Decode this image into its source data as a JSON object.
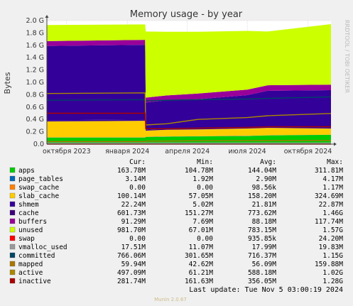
{
  "chart_data": {
    "type": "area",
    "title": "Memory usage - by year",
    "ylabel": "Bytes",
    "watermark": "RRDTOOL / TOBI OETIKER",
    "ylim": [
      0,
      2.0
    ],
    "y_unit_note": "values in GB (tick labels 'G')",
    "y_ticks": [
      "0.0",
      "0.2 G",
      "0.4 G",
      "0.6 G",
      "0.8 G",
      "1.0 G",
      "1.2 G",
      "1.4 G",
      "1.6 G",
      "1.8 G",
      "2.0 G"
    ],
    "x_tick_labels": [
      "октября 2023",
      "января 2024",
      "апреля 2024",
      "июля 2024",
      "октября 2024"
    ],
    "x_range": [
      "2023-09-01",
      "2024-11-05"
    ],
    "x_ticks": [
      "2023-10-01",
      "2024-01-01",
      "2024-04-01",
      "2024-07-01",
      "2024-10-01"
    ],
    "x": [
      "2023-09-01",
      "2024-01-28",
      "2024-01-29",
      "2024-03-01",
      "2024-04-17",
      "2024-07-01",
      "2024-08-01",
      "2024-11-05"
    ],
    "stack_series": [
      {
        "name": "apps",
        "color": "#00cc00",
        "values": [
          0.105,
          0.105,
          0.115,
          0.12,
          0.125,
          0.13,
          0.14,
          0.15
        ]
      },
      {
        "name": "page_tables",
        "color": "#0066b3",
        "values": [
          0.003,
          0.003,
          0.003,
          0.003,
          0.003,
          0.003,
          0.003,
          0.003
        ]
      },
      {
        "name": "slab_cache",
        "color": "#ffcc00",
        "values": [
          0.26,
          0.27,
          0.1,
          0.11,
          0.11,
          0.12,
          0.12,
          0.1
        ]
      },
      {
        "name": "shmem",
        "color": "#330099",
        "values": [
          0.02,
          0.02,
          0.015,
          0.015,
          0.02,
          0.02,
          0.02,
          0.02
        ]
      },
      {
        "name": "cache",
        "color": "#330099",
        "values": [
          1.2,
          1.21,
          0.44,
          0.46,
          0.47,
          0.52,
          0.58,
          0.6
        ]
      },
      {
        "name": "buffers",
        "color": "#990099",
        "values": [
          0.08,
          0.08,
          0.08,
          0.08,
          0.09,
          0.09,
          0.09,
          0.09
        ]
      },
      {
        "name": "unused",
        "color": "#ccff00",
        "values": [
          0.26,
          0.25,
          1.07,
          1.03,
          1.0,
          0.95,
          0.87,
          0.98
        ]
      }
    ],
    "line_series": [
      {
        "name": "swap",
        "color": "#ff0000",
        "values": [
          0.0,
          0.0,
          0.0,
          0.0,
          0.0,
          0.0,
          0.0,
          0.0
        ]
      },
      {
        "name": "vmalloc_used",
        "color": "#999999",
        "values": [
          0.018,
          0.018,
          0.018,
          0.018,
          0.018,
          0.018,
          0.018,
          0.018
        ]
      },
      {
        "name": "committed",
        "color": "#004466",
        "values": [
          0.71,
          0.72,
          0.7,
          0.71,
          0.72,
          0.73,
          0.74,
          0.766
        ]
      },
      {
        "name": "mapped",
        "color": "#aa7700",
        "values": [
          0.043,
          0.043,
          0.05,
          0.05,
          0.055,
          0.056,
          0.058,
          0.06
        ]
      },
      {
        "name": "active",
        "color": "#aa8800",
        "values": [
          0.82,
          0.83,
          0.31,
          0.33,
          0.4,
          0.43,
          0.46,
          0.497
        ]
      },
      {
        "name": "inactive",
        "color": "#aa0000",
        "values": [
          0.5,
          0.5,
          0.25,
          0.25,
          0.26,
          0.27,
          0.28,
          0.282
        ]
      }
    ],
    "grid": true,
    "legend_columns": [
      "Cur:",
      "Min:",
      "Avg:",
      "Max:"
    ],
    "legend": [
      {
        "name": "apps",
        "color": "#00cc00",
        "cur": "163.78M",
        "min": "104.78M",
        "avg": "144.04M",
        "max": "311.81M"
      },
      {
        "name": "page_tables",
        "color": "#0066b3",
        "cur": "3.14M",
        "min": "1.92M",
        "avg": "2.90M",
        "max": "4.17M"
      },
      {
        "name": "swap_cache",
        "color": "#ff8000",
        "cur": "0.00",
        "min": "0.00",
        "avg": "98.56k",
        "max": "1.17M"
      },
      {
        "name": "slab_cache",
        "color": "#ffcc00",
        "cur": "100.14M",
        "min": "57.05M",
        "avg": "158.20M",
        "max": "324.69M"
      },
      {
        "name": "shmem",
        "color": "#330099",
        "cur": "22.24M",
        "min": "5.02M",
        "avg": "21.81M",
        "max": "22.87M"
      },
      {
        "name": "cache",
        "color": "#3d007a",
        "cur": "601.73M",
        "min": "151.27M",
        "avg": "773.62M",
        "max": "1.46G"
      },
      {
        "name": "buffers",
        "color": "#990099",
        "cur": "91.29M",
        "min": "7.69M",
        "avg": "88.18M",
        "max": "117.74M"
      },
      {
        "name": "unused",
        "color": "#ccff00",
        "cur": "981.70M",
        "min": "67.01M",
        "avg": "783.15M",
        "max": "1.57G"
      },
      {
        "name": "swap",
        "color": "#ff0000",
        "cur": "0.00",
        "min": "0.00",
        "avg": "935.85k",
        "max": "24.20M"
      },
      {
        "name": "vmalloc_used",
        "color": "#999999",
        "cur": "17.51M",
        "min": "11.07M",
        "avg": "17.99M",
        "max": "19.83M"
      },
      {
        "name": "committed",
        "color": "#004466",
        "cur": "766.06M",
        "min": "301.65M",
        "avg": "716.37M",
        "max": "1.15G"
      },
      {
        "name": "mapped",
        "color": "#aa7700",
        "cur": "59.94M",
        "min": "42.62M",
        "avg": "56.09M",
        "max": "159.88M"
      },
      {
        "name": "active",
        "color": "#aa8800",
        "cur": "497.09M",
        "min": "61.21M",
        "avg": "588.18M",
        "max": "1.02G"
      },
      {
        "name": "inactive",
        "color": "#aa0000",
        "cur": "281.74M",
        "min": "161.63M",
        "avg": "356.05M",
        "max": "1.28G"
      }
    ],
    "last_update": "Last update: Tue Nov  5 03:00:19 2024",
    "footer": "Munin 2.0.67"
  }
}
